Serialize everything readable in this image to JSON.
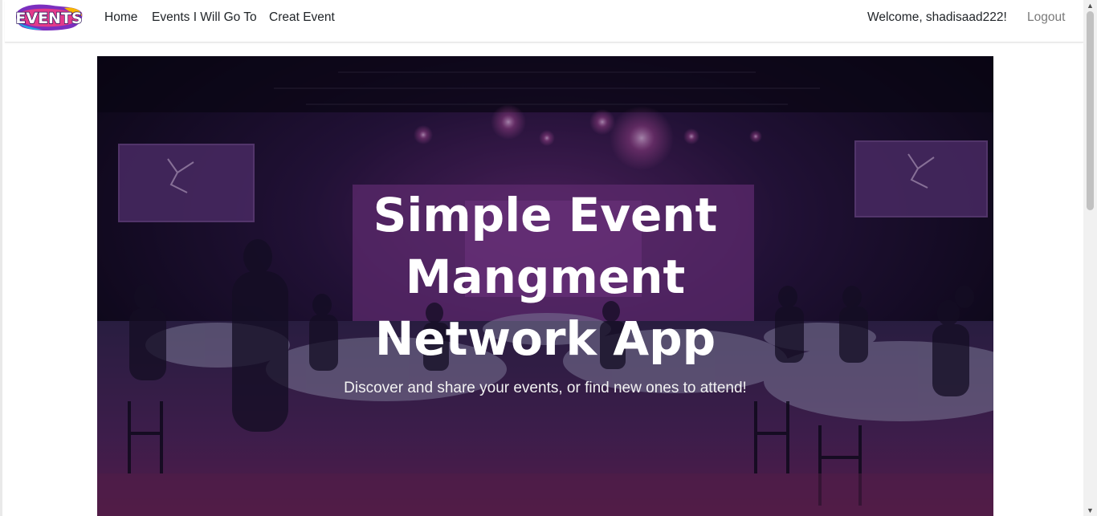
{
  "navbar": {
    "brand_text": "EVENTS",
    "links": [
      "Home",
      "Events I Will Go To",
      "Creat Event"
    ],
    "welcome": "Welcome, shadisaad222!",
    "logout": "Logout"
  },
  "hero": {
    "title": "Simple Event Mangment Network App",
    "subtitle": "Discover and share your events, or find new ones to attend!"
  },
  "scrollbar": {
    "up_arrow": "▲",
    "down_arrow": "▼"
  }
}
